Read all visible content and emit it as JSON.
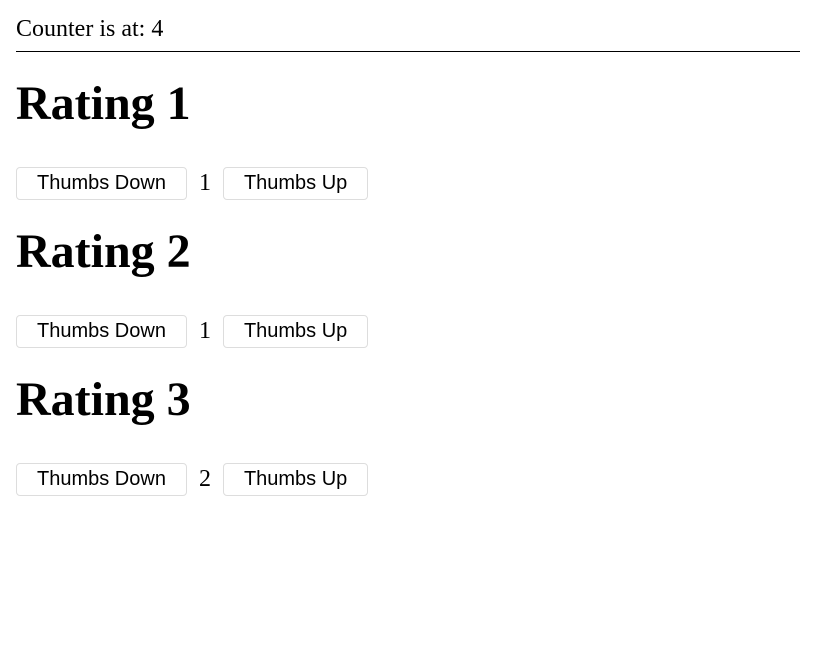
{
  "counter": {
    "label": "Counter is at: ",
    "value": "4"
  },
  "ratings": [
    {
      "title": "Rating 1",
      "down_label": "Thumbs Down",
      "up_label": "Thumbs Up",
      "value": "1"
    },
    {
      "title": "Rating 2",
      "down_label": "Thumbs Down",
      "up_label": "Thumbs Up",
      "value": "1"
    },
    {
      "title": "Rating 3",
      "down_label": "Thumbs Down",
      "up_label": "Thumbs Up",
      "value": "2"
    }
  ]
}
